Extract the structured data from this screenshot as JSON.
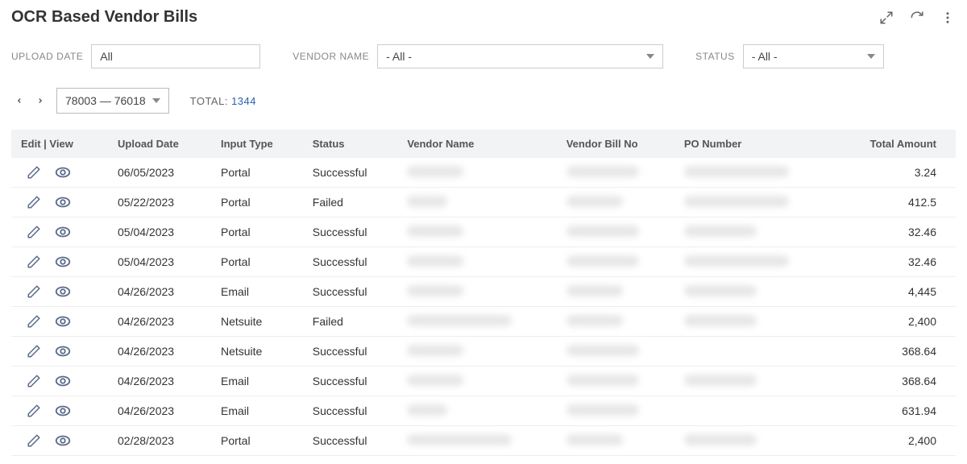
{
  "header": {
    "title": "OCR Based Vendor Bills"
  },
  "filters": {
    "upload_date": {
      "label": "UPLOAD DATE",
      "value": "All"
    },
    "vendor_name": {
      "label": "VENDOR NAME",
      "value": "- All -"
    },
    "status": {
      "label": "STATUS",
      "value": "- All -"
    }
  },
  "pager": {
    "range": "78003 — 76018",
    "total_label": "TOTAL:",
    "total_count": "1344"
  },
  "columns": {
    "editview": "Edit | View",
    "upload_date": "Upload Date",
    "input_type": "Input Type",
    "status": "Status",
    "vendor_name": "Vendor Name",
    "vendor_bill_no": "Vendor Bill No",
    "po_number": "PO Number",
    "total_amount": "Total Amount"
  },
  "rows": [
    {
      "upload_date": "06/05/2023",
      "input_type": "Portal",
      "status": "Successful",
      "vendor_name": "",
      "vendor_bill_no": "",
      "po_number": "",
      "total_amount": "3.24"
    },
    {
      "upload_date": "05/22/2023",
      "input_type": "Portal",
      "status": "Failed",
      "vendor_name": "",
      "vendor_bill_no": "",
      "po_number": "",
      "total_amount": "412.5"
    },
    {
      "upload_date": "05/04/2023",
      "input_type": "Portal",
      "status": "Successful",
      "vendor_name": "",
      "vendor_bill_no": "",
      "po_number": "",
      "total_amount": "32.46"
    },
    {
      "upload_date": "05/04/2023",
      "input_type": "Portal",
      "status": "Successful",
      "vendor_name": "",
      "vendor_bill_no": "",
      "po_number": "",
      "total_amount": "32.46"
    },
    {
      "upload_date": "04/26/2023",
      "input_type": "Email",
      "status": "Successful",
      "vendor_name": "",
      "vendor_bill_no": "",
      "po_number": "",
      "total_amount": "4,445"
    },
    {
      "upload_date": "04/26/2023",
      "input_type": "Netsuite",
      "status": "Failed",
      "vendor_name": "",
      "vendor_bill_no": "",
      "po_number": "",
      "total_amount": "2,400"
    },
    {
      "upload_date": "04/26/2023",
      "input_type": "Netsuite",
      "status": "Successful",
      "vendor_name": "",
      "vendor_bill_no": "",
      "po_number": "",
      "total_amount": "368.64"
    },
    {
      "upload_date": "04/26/2023",
      "input_type": "Email",
      "status": "Successful",
      "vendor_name": "",
      "vendor_bill_no": "",
      "po_number": "",
      "total_amount": "368.64"
    },
    {
      "upload_date": "04/26/2023",
      "input_type": "Email",
      "status": "Successful",
      "vendor_name": "",
      "vendor_bill_no": "",
      "po_number": "",
      "total_amount": "631.94"
    },
    {
      "upload_date": "02/28/2023",
      "input_type": "Portal",
      "status": "Successful",
      "vendor_name": "",
      "vendor_bill_no": "",
      "po_number": "",
      "total_amount": "2,400"
    }
  ]
}
